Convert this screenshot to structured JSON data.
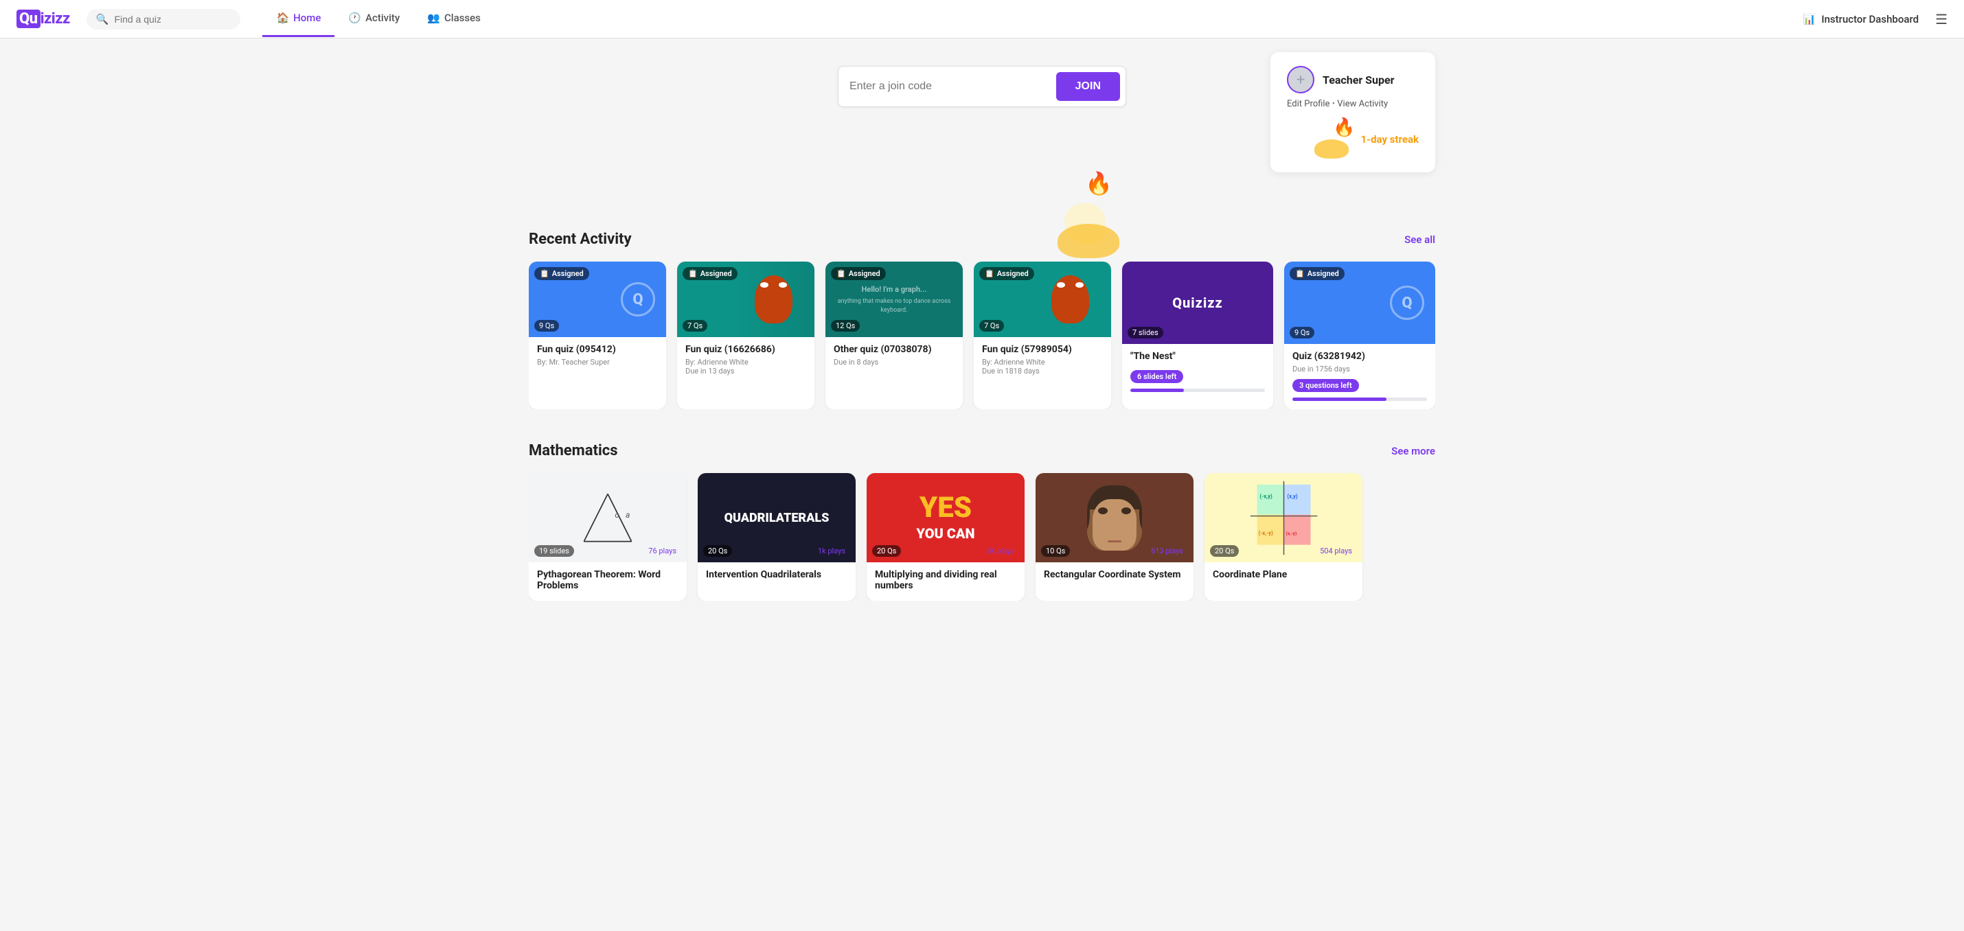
{
  "nav": {
    "logo": "Quizizz",
    "search_placeholder": "Find a quiz",
    "links": [
      {
        "label": "Home",
        "icon": "🏠",
        "active": true
      },
      {
        "label": "Activity",
        "icon": "🕐",
        "active": false
      },
      {
        "label": "Classes",
        "icon": "👥",
        "active": false
      }
    ],
    "instructor_dashboard": "Instructor Dashboard"
  },
  "join": {
    "placeholder": "Enter a join code",
    "button": "JOIN"
  },
  "profile": {
    "name": "Teacher Super",
    "edit_profile": "Edit Profile",
    "view_activity": "View Activity",
    "streak": "1-day streak"
  },
  "recent_activity": {
    "title": "Recent Activity",
    "see_all": "See all",
    "cards": [
      {
        "title": "Fun quiz (095412)",
        "by": "Mr. Teacher Super",
        "due": null,
        "q_count": "9 Qs",
        "color": "blue",
        "assigned": true,
        "progress": null
      },
      {
        "title": "Fun quiz (16626686)",
        "by": "Adrienne White",
        "due": "Due in 13 days",
        "q_count": "7 Qs",
        "color": "teal",
        "assigned": true,
        "progress": null
      },
      {
        "title": "Other quiz (07038078)",
        "by": null,
        "due": "Due in 8 days",
        "q_count": "12 Qs",
        "color": "dark-teal",
        "assigned": true,
        "progress": null
      },
      {
        "title": "Fun quiz (57989054)",
        "by": "Adrienne White",
        "due": "Due in 1818 days",
        "q_count": "7 Qs",
        "color": "teal",
        "assigned": true,
        "progress": null
      },
      {
        "title": "\"The Nest\"",
        "by": null,
        "due": null,
        "q_count": "7 slides",
        "color": "quizizz-dark",
        "assigned": false,
        "slides_left": "6 slides left",
        "progress": 40
      },
      {
        "title": "Quiz (63281942)",
        "by": null,
        "due": "Due in 1756 days",
        "q_count": "9 Qs",
        "color": "blue",
        "assigned": true,
        "questions_left": "3 questions left",
        "progress": 70
      }
    ]
  },
  "mathematics": {
    "title": "Mathematics",
    "see_more": "See more",
    "cards": [
      {
        "title": "Pythagorean Theorem: Word Problems",
        "slides": "19 slides",
        "plays": "76 plays",
        "type": "pyth"
      },
      {
        "title": "Intervention Quadrilaterals",
        "q_count": "20 Qs",
        "plays": "1k plays",
        "type": "quad"
      },
      {
        "title": "Multiplying and dividing real numbers",
        "q_count": "20 Qs",
        "plays": "8k plays",
        "type": "yes"
      },
      {
        "title": "Rectangular Coordinate System",
        "q_count": "10 Qs",
        "plays": "613 plays",
        "type": "descartes"
      },
      {
        "title": "Coordinate Plane",
        "q_count": "20 Qs",
        "plays": "504 plays",
        "type": "coord"
      }
    ]
  }
}
